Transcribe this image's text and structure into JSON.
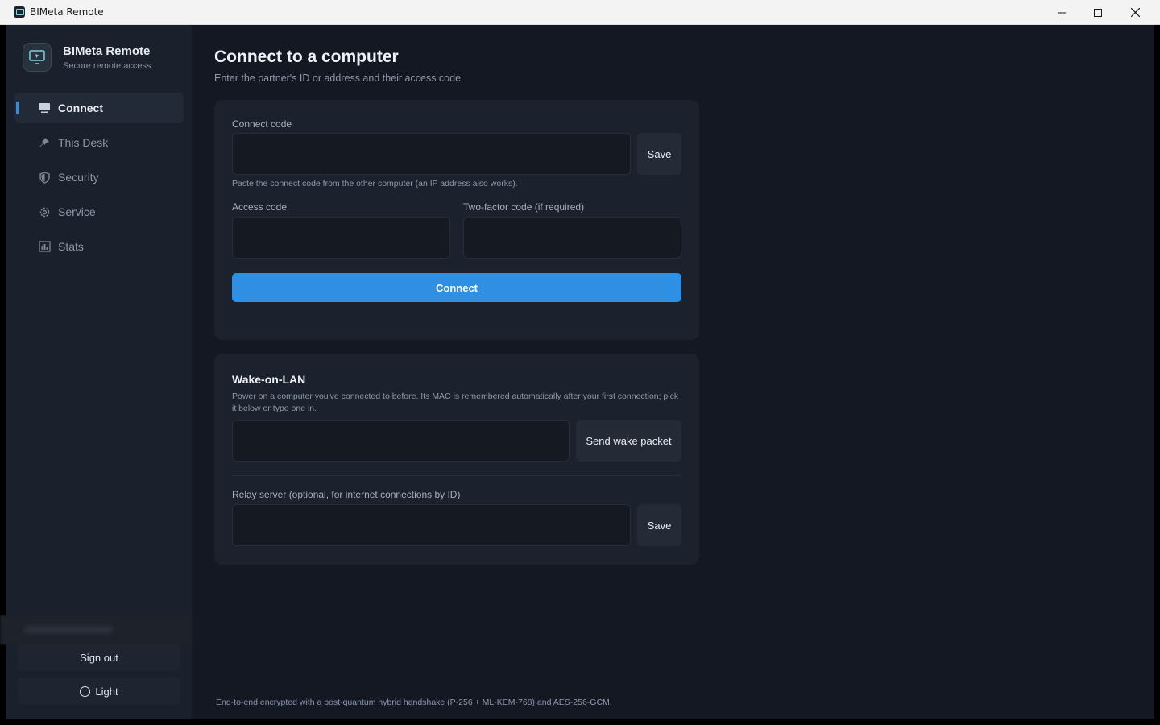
{
  "window": {
    "title": "BIMeta Remote"
  },
  "sidebar": {
    "brand_name": "BIMeta Remote",
    "brand_subtitle": "Secure remote access",
    "items": [
      {
        "label": "Connect",
        "icon": "monitor-icon",
        "active": true
      },
      {
        "label": "This Desk",
        "icon": "pin-icon",
        "active": false
      },
      {
        "label": "Security",
        "icon": "shield-icon",
        "active": false
      },
      {
        "label": "Service",
        "icon": "gear-icon",
        "active": false
      },
      {
        "label": "Stats",
        "icon": "bar-chart-icon",
        "active": false
      }
    ],
    "sign_out_label": "Sign out",
    "theme_label": "Light"
  },
  "main": {
    "title": "Connect to a computer",
    "subtitle": "Enter the partner's ID or address and their access code.",
    "connect_card": {
      "connect_code_label": "Connect code",
      "connect_code_value": "",
      "save_label": "Save",
      "connect_code_hint": "Paste the connect code from the other computer (an IP address also works).",
      "access_code_label": "Access code",
      "access_code_value": "",
      "two_factor_label": "Two-factor code (if required)",
      "two_factor_value": "",
      "connect_button_label": "Connect"
    },
    "wol_card": {
      "title": "Wake-on-LAN",
      "description": "Power on a computer you've connected to before. Its MAC is remembered automatically after your first connection; pick it below or type one in.",
      "mac_value": "",
      "send_button_label": "Send wake packet",
      "relay_label": "Relay server (optional, for internet connections by ID)",
      "relay_value": "",
      "relay_save_label": "Save"
    },
    "footer_note": "End-to-end encrypted with a post-quantum hybrid handshake (P-256 + ML-KEM-768) and AES-256-GCM."
  },
  "colors": {
    "accent": "#2f8fe3",
    "background": "#131823",
    "sidebar": "#1a202c",
    "card": "#1c222d"
  }
}
